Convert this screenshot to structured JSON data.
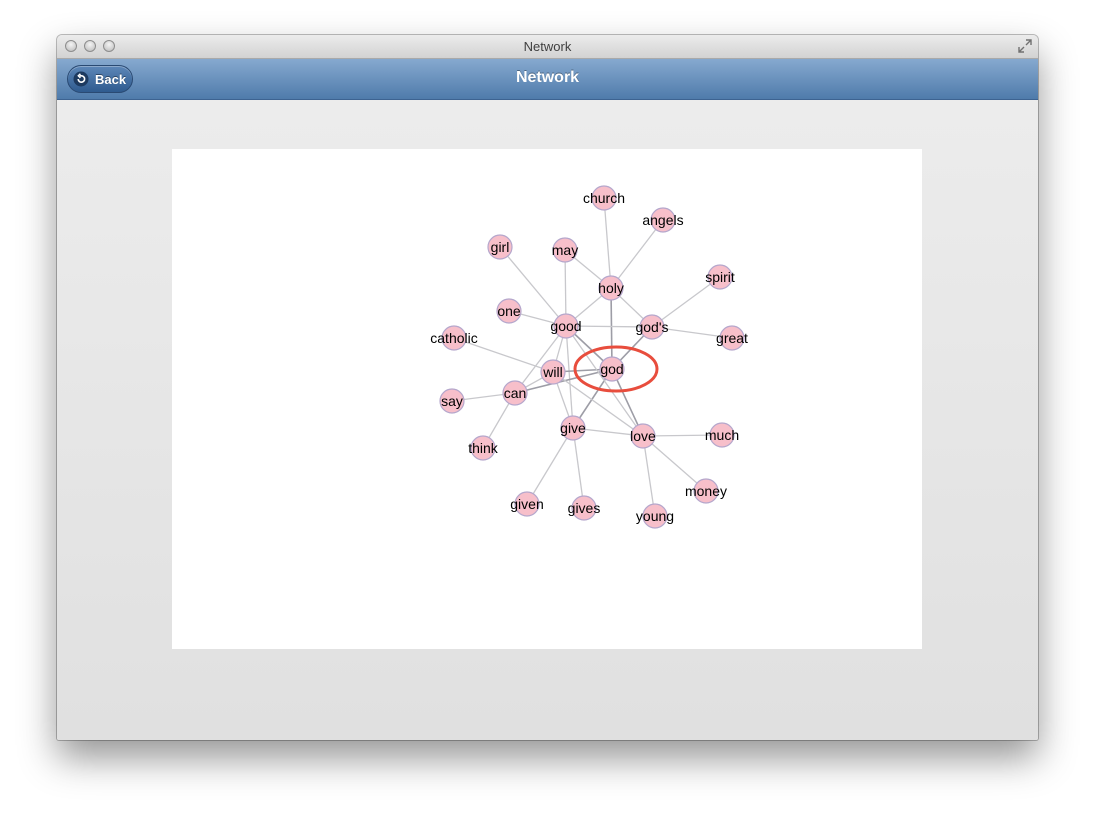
{
  "window": {
    "title": "Network"
  },
  "navbar": {
    "back_label": "Back",
    "title": "Network"
  },
  "network": {
    "nodes": [
      {
        "id": "church",
        "label": "church"
      },
      {
        "id": "angels",
        "label": "angels"
      },
      {
        "id": "girl",
        "label": "girl"
      },
      {
        "id": "may",
        "label": "may"
      },
      {
        "id": "spirit",
        "label": "spirit"
      },
      {
        "id": "holy",
        "label": "holy"
      },
      {
        "id": "one",
        "label": "one"
      },
      {
        "id": "good",
        "label": "good"
      },
      {
        "id": "gods",
        "label": "god's"
      },
      {
        "id": "great",
        "label": "great"
      },
      {
        "id": "catholic",
        "label": "catholic"
      },
      {
        "id": "god",
        "label": "god",
        "highlighted": true
      },
      {
        "id": "will",
        "label": "will"
      },
      {
        "id": "can",
        "label": "can"
      },
      {
        "id": "say",
        "label": "say"
      },
      {
        "id": "give",
        "label": "give"
      },
      {
        "id": "love",
        "label": "love"
      },
      {
        "id": "much",
        "label": "much"
      },
      {
        "id": "think",
        "label": "think"
      },
      {
        "id": "money",
        "label": "money"
      },
      {
        "id": "given",
        "label": "given"
      },
      {
        "id": "gives",
        "label": "gives"
      },
      {
        "id": "young",
        "label": "young"
      }
    ],
    "edges": [
      [
        "church",
        "holy"
      ],
      [
        "angels",
        "holy"
      ],
      [
        "girl",
        "good"
      ],
      [
        "may",
        "good"
      ],
      [
        "may",
        "holy"
      ],
      [
        "spirit",
        "gods"
      ],
      [
        "holy",
        "good"
      ],
      [
        "holy",
        "gods"
      ],
      [
        "holy",
        "god"
      ],
      [
        "one",
        "good"
      ],
      [
        "good",
        "gods"
      ],
      [
        "good",
        "will"
      ],
      [
        "good",
        "can"
      ],
      [
        "good",
        "god"
      ],
      [
        "good",
        "give"
      ],
      [
        "gods",
        "great"
      ],
      [
        "gods",
        "god"
      ],
      [
        "catholic",
        "will"
      ],
      [
        "god",
        "will"
      ],
      [
        "god",
        "give"
      ],
      [
        "god",
        "love"
      ],
      [
        "god",
        "can"
      ],
      [
        "will",
        "can"
      ],
      [
        "will",
        "give"
      ],
      [
        "will",
        "love"
      ],
      [
        "can",
        "say"
      ],
      [
        "can",
        "think"
      ],
      [
        "give",
        "given"
      ],
      [
        "give",
        "gives"
      ],
      [
        "give",
        "love"
      ],
      [
        "love",
        "much"
      ],
      [
        "love",
        "money"
      ],
      [
        "love",
        "young"
      ],
      [
        "good",
        "love"
      ]
    ],
    "colors": {
      "node_fill": "#f7bfca",
      "node_stroke": "#b5a7cc",
      "edge": "#c8c8cc",
      "highlight": "#e84d3d"
    }
  }
}
